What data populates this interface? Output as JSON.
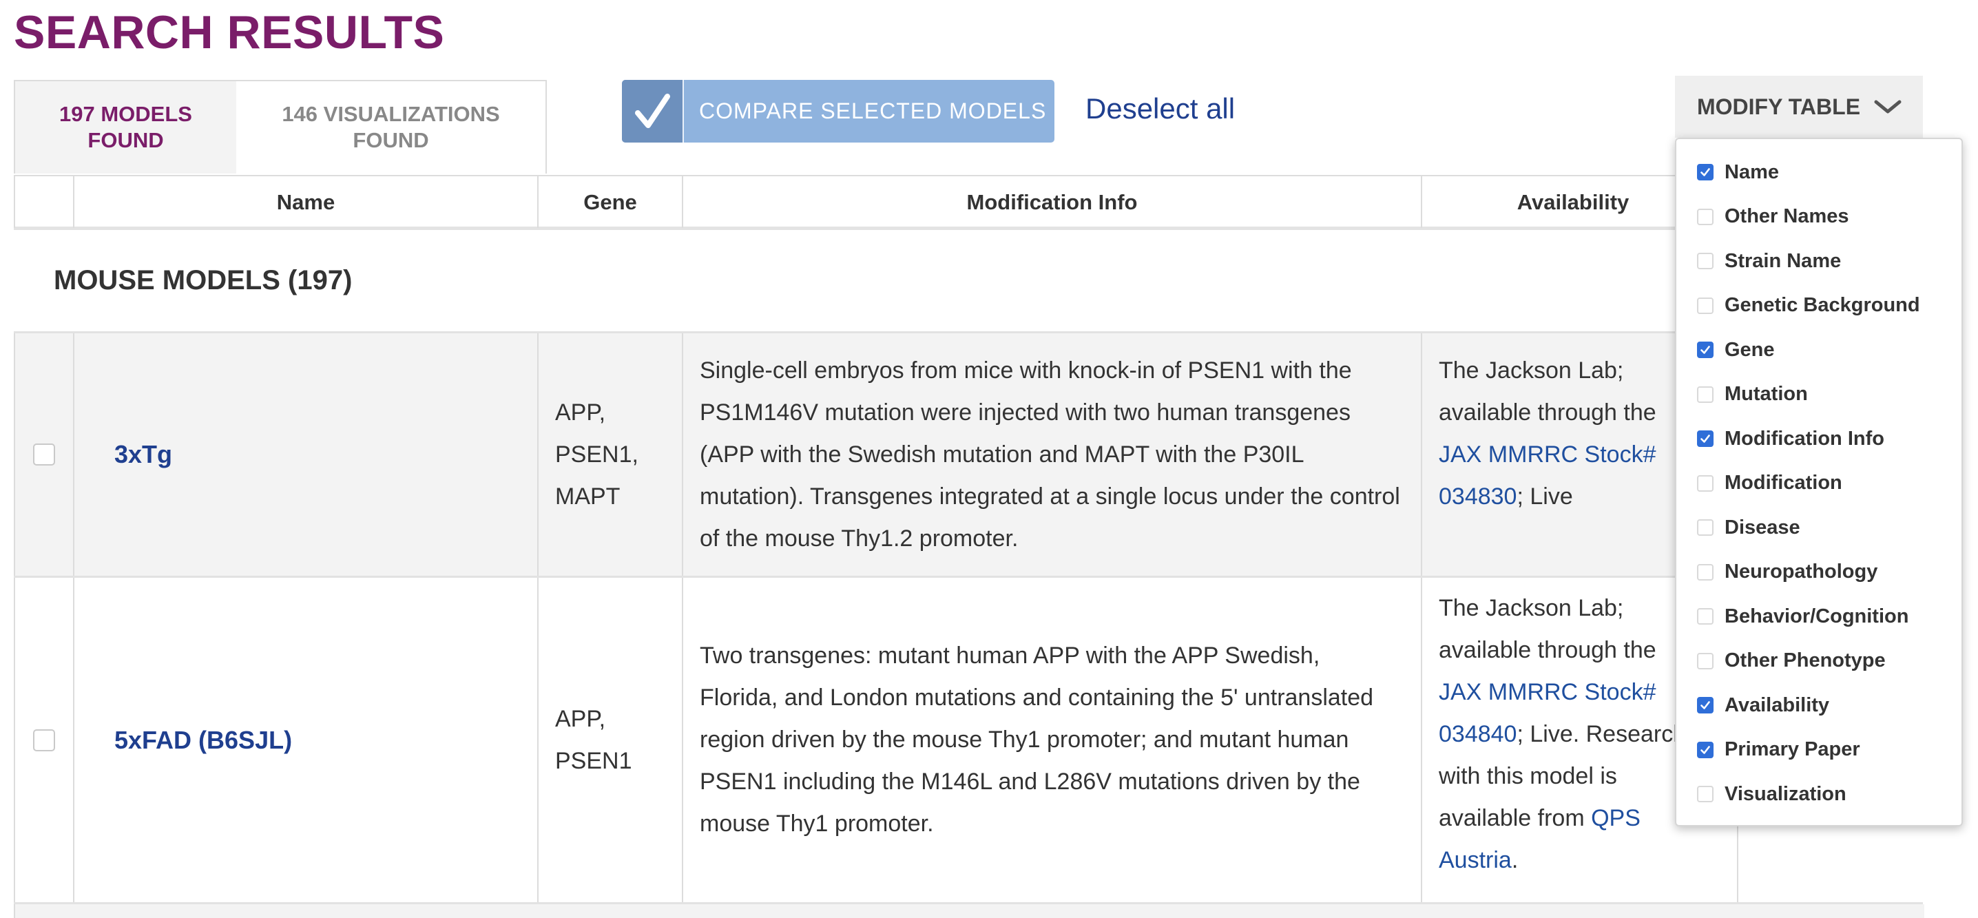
{
  "page": {
    "title": "SEARCH RESULTS"
  },
  "tabs": [
    {
      "label": "197 MODELS FOUND",
      "active": true
    },
    {
      "label": "146 VISUALIZATIONS FOUND",
      "active": false
    }
  ],
  "toolbar": {
    "compare_label": "COMPARE SELECTED MODELS",
    "deselect_label": "Deselect all",
    "modify_label": "MODIFY TABLE"
  },
  "table": {
    "headers": [
      "Name",
      "Gene",
      "Modification Info",
      "Availability"
    ],
    "section_title": "MOUSE MODELS (197)",
    "rows": [
      {
        "name": "3xTg",
        "gene": "APP, PSEN1, MAPT",
        "modification": "Single-cell embryos from mice with knock-in of PSEN1 with the PS1M146V mutation were injected with two human transgenes (APP with the Swedish mutation and MAPT with the P30IL mutation). Transgenes integrated at a single locus under the control of the mouse Thy1.2 promoter.",
        "availability": {
          "line1": "The Jackson Lab;",
          "line2": "available through the",
          "link1": "JAX MMRRC Stock#",
          "link2": "034830",
          "tail": "; Live"
        }
      },
      {
        "name": "5xFAD (B6SJL)",
        "gene": "APP, PSEN1",
        "modification": "Two transgenes: mutant human APP with the APP Swedish, Florida, and London mutations and containing the 5' untranslated region driven by the mouse Thy1 promoter; and mutant human PSEN1 including the M146L and L286V mutations driven by the mouse Thy1 promoter.",
        "availability": {
          "line1": "The Jackson Lab;",
          "line2": "available through the",
          "link1": "JAX MMRRC Stock#",
          "link2": "034840",
          "tail": "; Live. Research",
          "line5": "with this model is",
          "line6_pre": "available from ",
          "link3": "QPS",
          "link4": "Austria",
          "end": "."
        }
      }
    ]
  },
  "modify_menu": {
    "options": [
      {
        "label": "Name",
        "checked": true
      },
      {
        "label": "Other Names",
        "checked": false
      },
      {
        "label": "Strain Name",
        "checked": false
      },
      {
        "label": "Genetic Background",
        "checked": false
      },
      {
        "label": "Gene",
        "checked": true
      },
      {
        "label": "Mutation",
        "checked": false
      },
      {
        "label": "Modification Info",
        "checked": true
      },
      {
        "label": "Modification",
        "checked": false
      },
      {
        "label": "Disease",
        "checked": false
      },
      {
        "label": "Neuropathology",
        "checked": false
      },
      {
        "label": "Behavior/Cognition",
        "checked": false
      },
      {
        "label": "Other Phenotype",
        "checked": false
      },
      {
        "label": "Availability",
        "checked": true
      },
      {
        "label": "Primary Paper",
        "checked": true
      },
      {
        "label": "Visualization",
        "checked": false
      }
    ]
  },
  "colors": {
    "brand": "#7a1d69",
    "link": "#1f3f8f",
    "accent_button": "#8fb3de",
    "checkbox_on": "#2f6ed8"
  }
}
